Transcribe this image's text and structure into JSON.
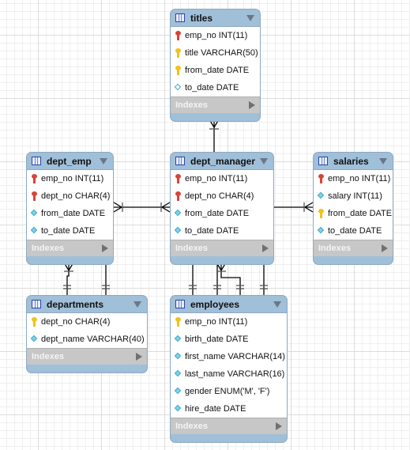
{
  "diagram": {
    "type": "EER diagram",
    "indexes_label": "Indexes",
    "entities": [
      {
        "id": "titles",
        "name": "titles",
        "columns": [
          {
            "text": "emp_no INT(11)",
            "icon": "pk-fk-key"
          },
          {
            "text": "title VARCHAR(50)",
            "icon": "pk-key"
          },
          {
            "text": "from_date DATE",
            "icon": "pk-key"
          },
          {
            "text": "to_date DATE",
            "icon": "nullable-column"
          }
        ]
      },
      {
        "id": "dept_emp",
        "name": "dept_emp",
        "columns": [
          {
            "text": "emp_no INT(11)",
            "icon": "pk-fk-key"
          },
          {
            "text": "dept_no CHAR(4)",
            "icon": "pk-fk-key"
          },
          {
            "text": "from_date DATE",
            "icon": "not-null-column"
          },
          {
            "text": "to_date DATE",
            "icon": "not-null-column"
          }
        ]
      },
      {
        "id": "dept_manager",
        "name": "dept_manager",
        "columns": [
          {
            "text": "emp_no INT(11)",
            "icon": "pk-fk-key"
          },
          {
            "text": "dept_no CHAR(4)",
            "icon": "pk-fk-key"
          },
          {
            "text": "from_date DATE",
            "icon": "not-null-column"
          },
          {
            "text": "to_date DATE",
            "icon": "not-null-column"
          }
        ]
      },
      {
        "id": "salaries",
        "name": "salaries",
        "columns": [
          {
            "text": "emp_no INT(11)",
            "icon": "pk-fk-key"
          },
          {
            "text": "salary INT(11)",
            "icon": "not-null-column"
          },
          {
            "text": "from_date DATE",
            "icon": "pk-key"
          },
          {
            "text": "to_date DATE",
            "icon": "not-null-column"
          }
        ]
      },
      {
        "id": "departments",
        "name": "departments",
        "columns": [
          {
            "text": "dept_no CHAR(4)",
            "icon": "pk-key"
          },
          {
            "text": "dept_name VARCHAR(40)",
            "icon": "not-null-column"
          }
        ]
      },
      {
        "id": "employees",
        "name": "employees",
        "columns": [
          {
            "text": "emp_no INT(11)",
            "icon": "pk-key"
          },
          {
            "text": "birth_date DATE",
            "icon": "not-null-column"
          },
          {
            "text": "first_name VARCHAR(14)",
            "icon": "not-null-column"
          },
          {
            "text": "last_name VARCHAR(16)",
            "icon": "not-null-column"
          },
          {
            "text": "gender ENUM('M', 'F')",
            "icon": "not-null-column"
          },
          {
            "text": "hire_date DATE",
            "icon": "not-null-column"
          }
        ]
      }
    ],
    "relationships": [
      {
        "from": "titles",
        "to": "dept_manager",
        "from_card": "many",
        "to_card": "one"
      },
      {
        "from": "dept_emp",
        "to": "dept_manager",
        "from_card": "many",
        "to_card": "many"
      },
      {
        "from": "dept_manager",
        "to": "salaries",
        "from_card": "one",
        "to_card": "many"
      },
      {
        "from": "dept_emp",
        "to": "departments",
        "from_card": "many",
        "to_card": "one"
      },
      {
        "from": "dept_emp",
        "to": "departments",
        "from_card": "one",
        "to_card": "one"
      },
      {
        "from": "dept_manager",
        "to": "employees",
        "from_card": "one",
        "to_card": "one"
      },
      {
        "from": "dept_manager",
        "to": "employees",
        "from_card": "many",
        "to_card": "one"
      },
      {
        "from": "dept_manager",
        "to": "employees",
        "from_card": "one",
        "to_card": "one"
      }
    ],
    "colors": {
      "header": "#a0bfd9",
      "indexes_bar": "#c7c7c7",
      "pk_fk_key": "#d9443a",
      "pk_key": "#f2c21b",
      "column_diamond": "#7fd3ea",
      "connector": "#000000"
    }
  }
}
